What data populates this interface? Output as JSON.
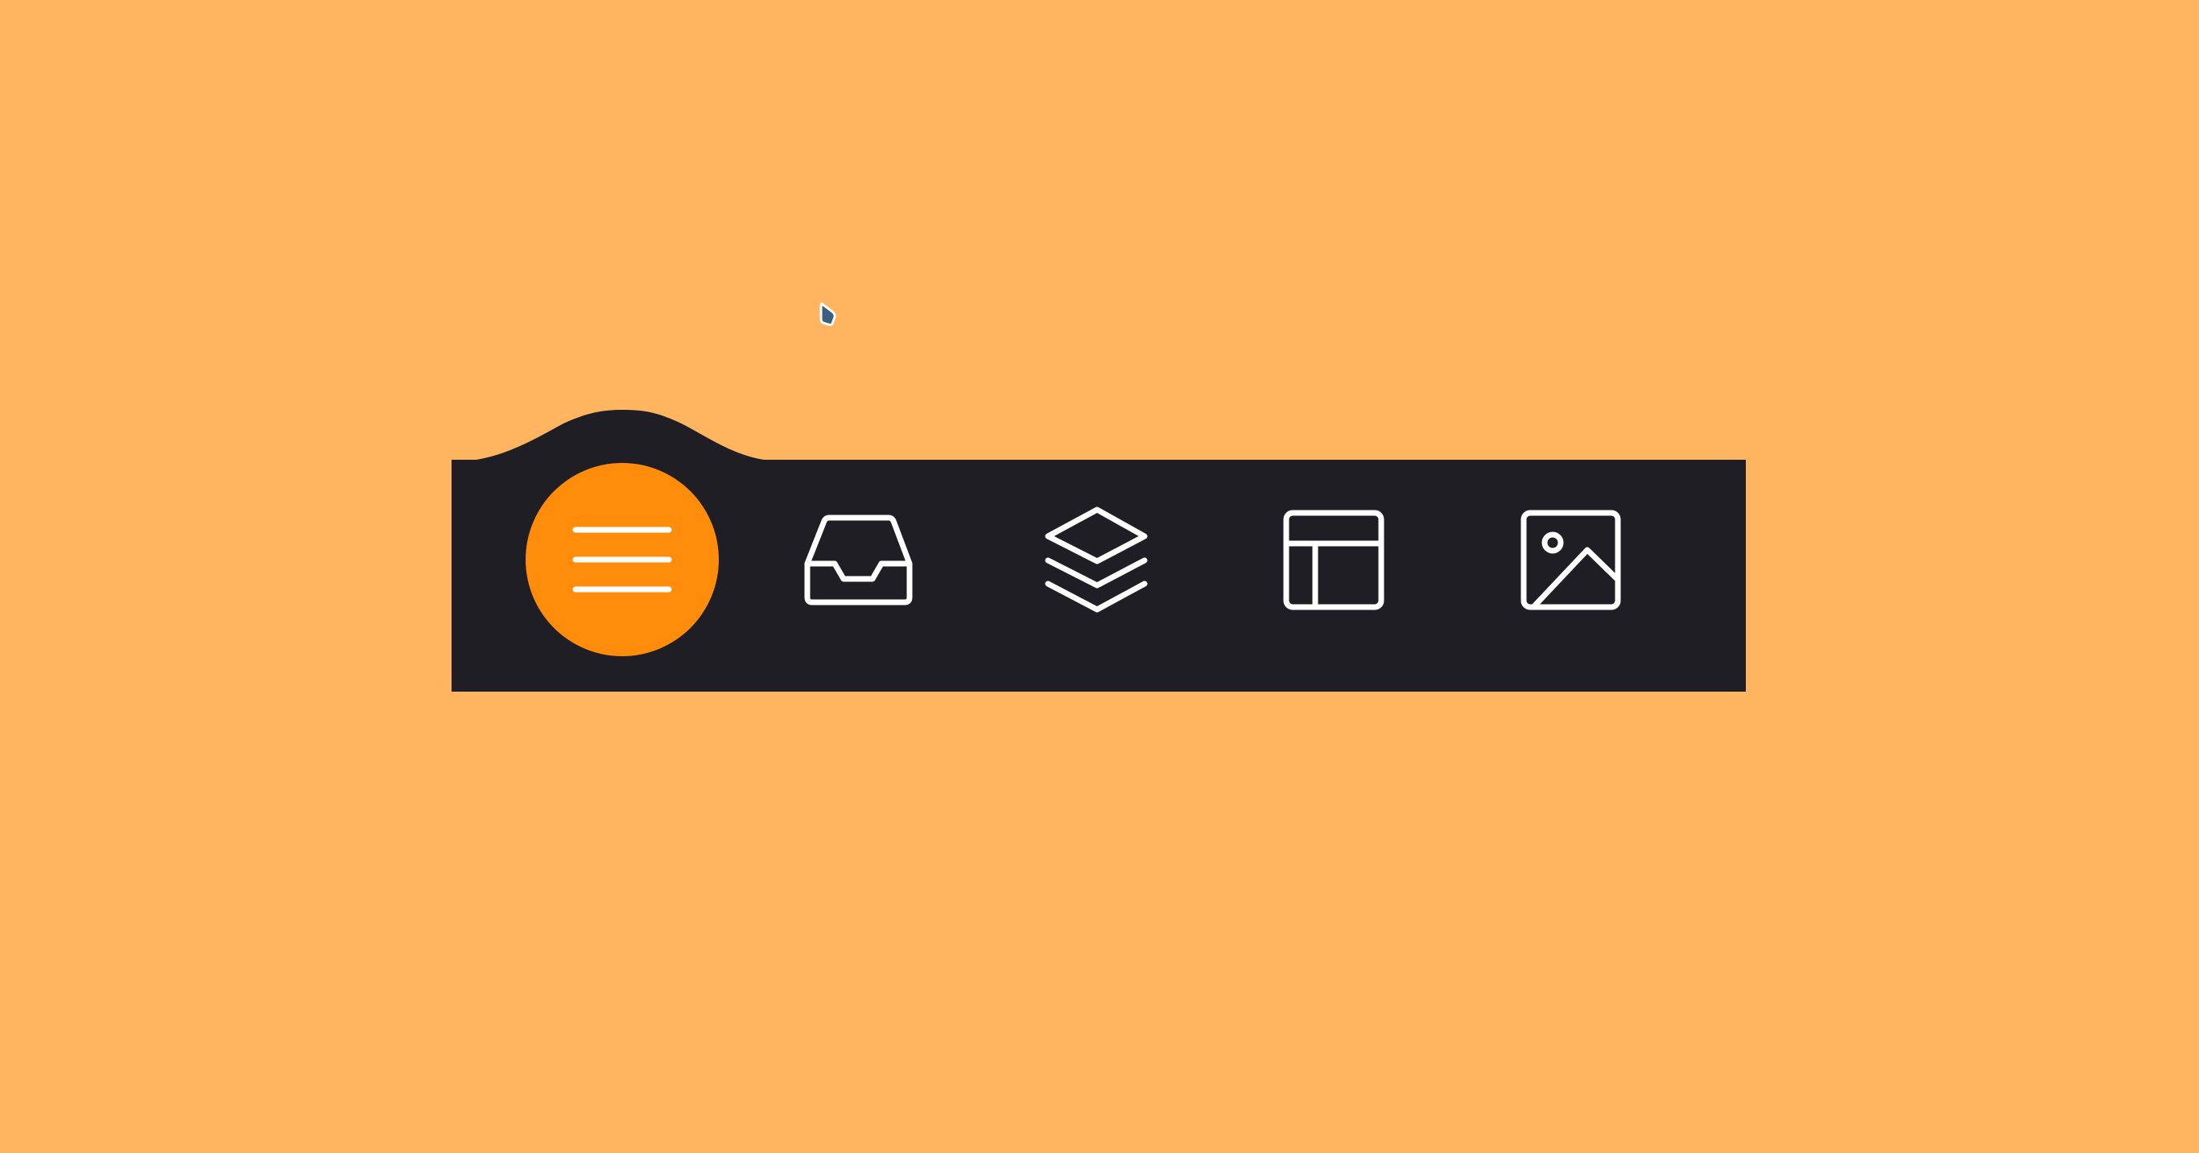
{
  "colors": {
    "background": "#FFB55F",
    "bar": "#1F1E25",
    "active": "#FF8C0A",
    "icon": "#FFFFFF",
    "cursor": "#3D5F7E"
  },
  "nav": {
    "items": [
      {
        "icon": "menu-icon",
        "active": true
      },
      {
        "icon": "inbox-icon",
        "active": false
      },
      {
        "icon": "layers-icon",
        "active": false
      },
      {
        "icon": "layout-icon",
        "active": false
      },
      {
        "icon": "image-icon",
        "active": false
      }
    ]
  }
}
